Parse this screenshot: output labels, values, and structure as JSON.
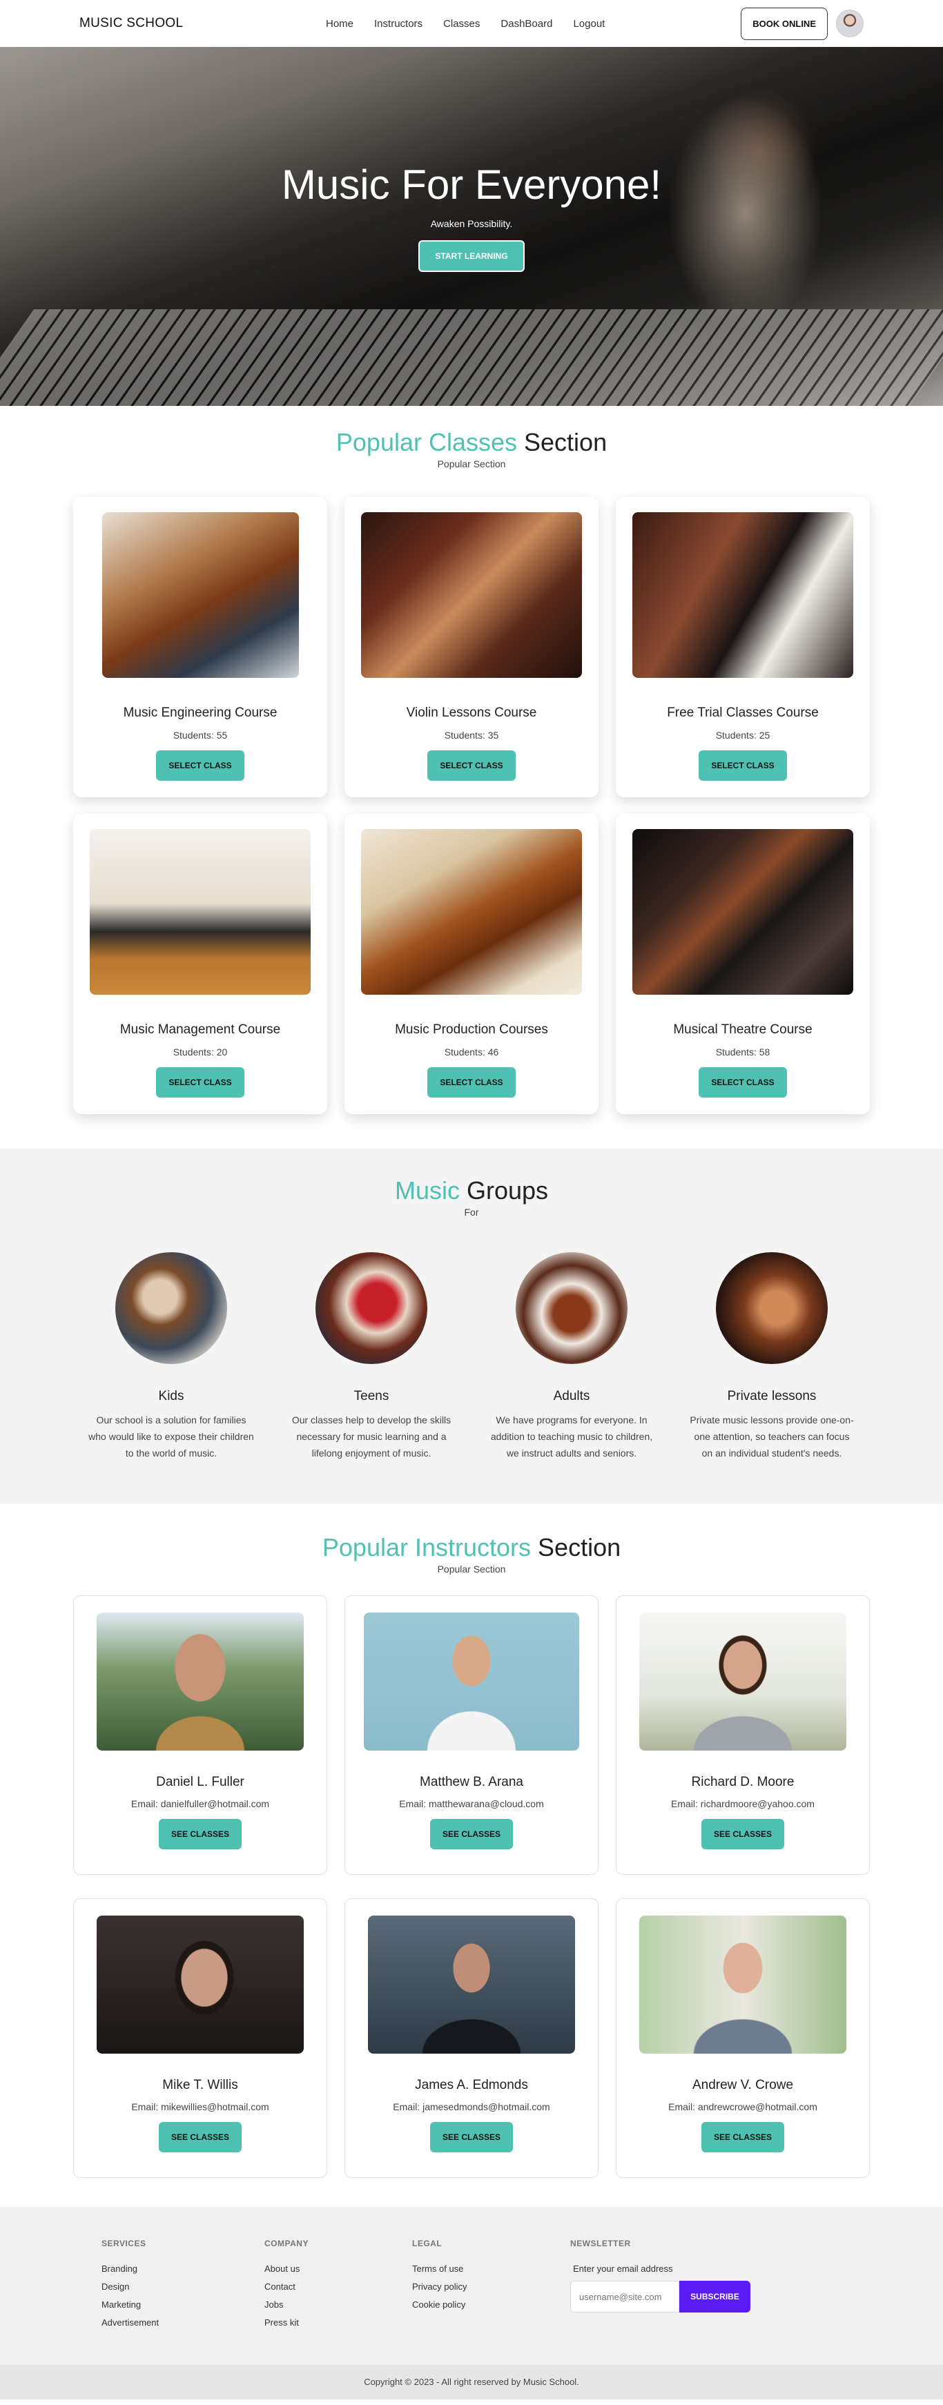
{
  "nav": {
    "brand": "MUSIC SCHOOL",
    "links": [
      "Home",
      "Instructors",
      "Classes",
      "DashBoard",
      "Logout"
    ],
    "book_button": "BOOK ONLINE"
  },
  "hero": {
    "title": "Music For Everyone!",
    "subtitle": "Awaken Possibility.",
    "cta": "START LEARNING"
  },
  "classes": {
    "heading_accent": "Popular Classes",
    "heading_rest": " Section",
    "subheading": "Popular Section",
    "items": [
      {
        "title": "Music Engineering Course",
        "students": "Students: 55",
        "button": "SELECT CLASS"
      },
      {
        "title": "Violin Lessons Course",
        "students": "Students: 35",
        "button": "SELECT CLASS"
      },
      {
        "title": "Free Trial Classes Course",
        "students": "Students: 25",
        "button": "SELECT CLASS"
      },
      {
        "title": "Music Management Course",
        "students": "Students: 20",
        "button": "SELECT CLASS"
      },
      {
        "title": "Music Production Courses",
        "students": "Students: 46",
        "button": "SELECT CLASS"
      },
      {
        "title": "Musical Theatre Course",
        "students": "Students: 58",
        "button": "SELECT CLASS"
      }
    ]
  },
  "groups": {
    "heading_accent": "Music",
    "heading_rest": " Groups",
    "subheading": "For",
    "items": [
      {
        "title": "Kids",
        "desc": "Our school is a solution for families who would like to expose their children to the world of music."
      },
      {
        "title": "Teens",
        "desc": "Our classes help to develop the skills necessary for music learning and a lifelong enjoyment of music."
      },
      {
        "title": "Adults",
        "desc": "We have programs for everyone. In addition to teaching music to children, we instruct adults and seniors."
      },
      {
        "title": "Private lessons",
        "desc": "Private music lessons provide one-on-one attention, so teachers can focus on an individual student's needs."
      }
    ]
  },
  "instructors": {
    "heading_accent": "Popular Instructors",
    "heading_rest": " Section",
    "subheading": "Popular Section",
    "items": [
      {
        "name": "Daniel L. Fuller",
        "email": "Email: danielfuller@hotmail.com",
        "button": "SEE CLASSES"
      },
      {
        "name": "Matthew B. Arana",
        "email": "Email: matthewarana@cloud.com",
        "button": "SEE CLASSES"
      },
      {
        "name": "Richard D. Moore",
        "email": "Email: richardmoore@yahoo.com",
        "button": "SEE CLASSES"
      },
      {
        "name": "Mike T. Willis",
        "email": "Email: mikewillies@hotmail.com",
        "button": "SEE CLASSES"
      },
      {
        "name": "James A. Edmonds",
        "email": "Email: jamesedmonds@hotmail.com",
        "button": "SEE CLASSES"
      },
      {
        "name": "Andrew V. Crowe",
        "email": "Email: andrewcrowe@hotmail.com",
        "button": "SEE CLASSES"
      }
    ]
  },
  "footer": {
    "services": {
      "title": "SERVICES",
      "links": [
        "Branding",
        "Design",
        "Marketing",
        "Advertisement"
      ]
    },
    "company": {
      "title": "COMPANY",
      "links": [
        "About us",
        "Contact",
        "Jobs",
        "Press kit"
      ]
    },
    "legal": {
      "title": "LEGAL",
      "links": [
        "Terms of use",
        "Privacy policy",
        "Cookie policy"
      ]
    },
    "newsletter": {
      "title": "NEWSLETTER",
      "label": "Enter your email address",
      "placeholder": "username@site.com",
      "button": "SUBSCRIBE"
    },
    "copyright": "Copyright © 2023 - All right reserved by Music School."
  },
  "colors": {
    "accent": "#4fc1b3",
    "subscribe": "#5a1bf5"
  }
}
